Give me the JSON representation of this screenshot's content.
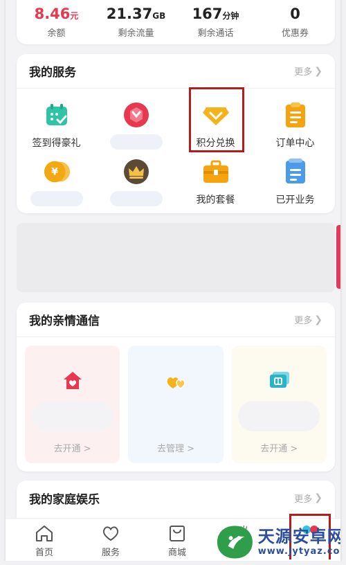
{
  "stats": [
    {
      "value": "8.46",
      "unit": "元",
      "label": "余额"
    },
    {
      "value": "21.37",
      "unit": "GB",
      "label": "剩余流量"
    },
    {
      "value": "167",
      "unit": "分钟",
      "label": "剩余通话"
    },
    {
      "value": "0",
      "unit": "",
      "label": "优惠券"
    }
  ],
  "services": {
    "title": "我的服务",
    "more": "更多",
    "items": [
      {
        "label": "签到得豪礼",
        "icon": "calendar-check-icon"
      },
      {
        "label": "",
        "icon": "gift-badge-icon"
      },
      {
        "label": "积分兑换",
        "icon": "diamond-icon"
      },
      {
        "label": "订单中心",
        "icon": "clipboard-icon"
      },
      {
        "label": "",
        "icon": "yen-coin-icon"
      },
      {
        "label": "",
        "icon": "crown-icon"
      },
      {
        "label": "我的套餐",
        "icon": "briefcase-icon"
      },
      {
        "label": "已开业务",
        "icon": "document-icon"
      }
    ]
  },
  "family": {
    "title": "我的亲情通信",
    "more": "更多",
    "tiles": [
      {
        "action": "去开通 >",
        "icon": "house-heart-icon"
      },
      {
        "action": "去管理 >",
        "icon": "hearts-icon"
      },
      {
        "action": "去开通 >",
        "icon": "phone-card-icon"
      }
    ]
  },
  "entertainment": {
    "title": "我的家庭娱乐",
    "more": "更多"
  },
  "tabbar": [
    {
      "label": "首页",
      "icon": "home-icon"
    },
    {
      "label": "服务",
      "icon": "heart-outline-icon"
    },
    {
      "label": "商城",
      "icon": "shopping-bag-icon"
    }
  ],
  "watermark": {
    "title": "天源安卓网",
    "url": "www.jytyaz.com"
  },
  "colors": {
    "accent_red": "#e8384f",
    "highlight_box": "#b31c1c",
    "gold": "#f3b31b",
    "teal": "#2ec4a6"
  }
}
